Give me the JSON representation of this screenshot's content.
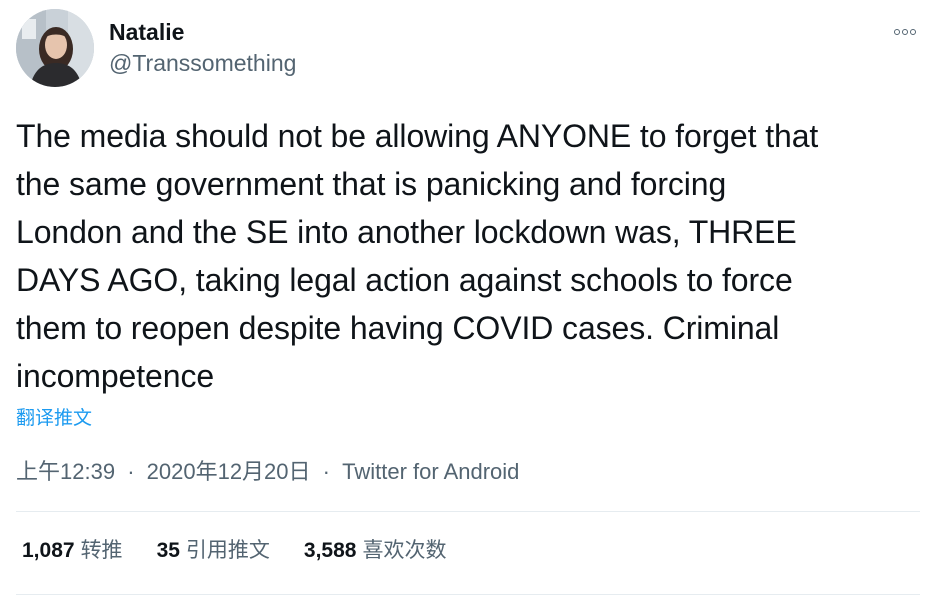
{
  "author": {
    "name": "Natalie",
    "handle": "@Transsomething"
  },
  "tweet": {
    "lines": [
      "The media should not be allowing ANYONE to forget that",
      "the same government that is panicking and forcing",
      "London and the SE into another lockdown was, THREE",
      "DAYS AGO, taking legal action against schools to force",
      "them to reopen despite having COVID cases. Criminal",
      "incompetence"
    ],
    "translate_label": "翻译推文"
  },
  "meta": {
    "time": "上午12:39",
    "separator": "·",
    "date": "2020年12月20日",
    "source": "Twitter for Android"
  },
  "stats": {
    "retweets": {
      "count": "1,087",
      "label": "转推"
    },
    "quotes": {
      "count": "35",
      "label": "引用推文"
    },
    "likes": {
      "count": "3,588",
      "label": "喜欢次数"
    }
  },
  "icons": {
    "more": "more-horizontal-icon"
  },
  "colors": {
    "text": "#0f1419",
    "secondary": "#536471",
    "link": "#1d9bf0",
    "divider": "#e6ecf0"
  }
}
